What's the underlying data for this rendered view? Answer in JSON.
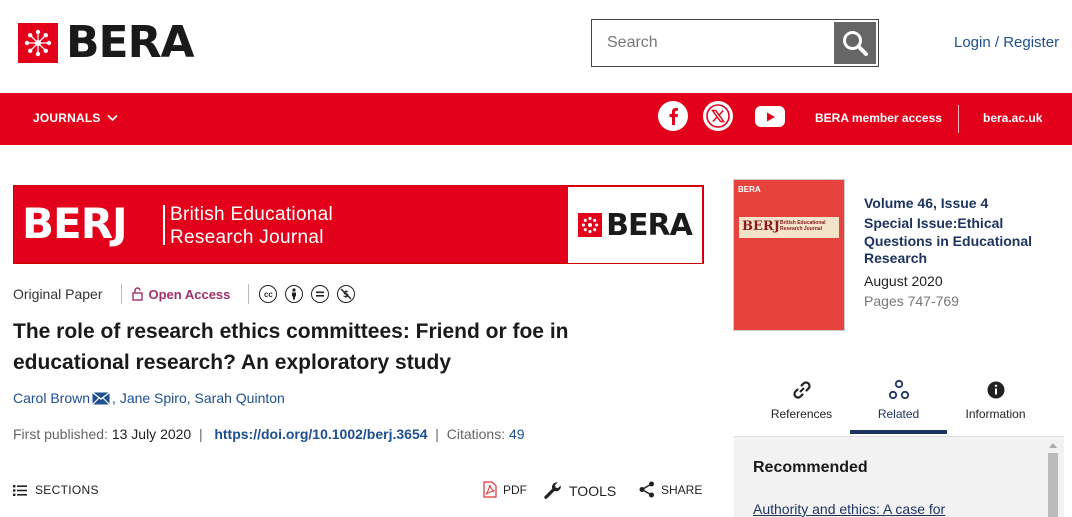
{
  "header": {
    "brand": "BERA",
    "search_placeholder": "Search",
    "login_label": "Login / Register"
  },
  "nav": {
    "journals_label": "JOURNALS",
    "member_access": "BERA member access",
    "site_link": "bera.ac.uk",
    "socials": [
      "facebook-icon",
      "x-icon",
      "youtube-icon"
    ]
  },
  "banner": {
    "abbr": "BERJ",
    "line1": "British Educational",
    "line2": "Research Journal",
    "brand": "BERA"
  },
  "article": {
    "type": "Original Paper",
    "access": "Open Access",
    "title": "The role of research ethics committees: Friend or foe in educational research? An exploratory study",
    "authors": [
      "Carol Brown",
      "Jane Spiro",
      "Sarah Quinton"
    ],
    "first_published_label": "First published:",
    "first_published_date": "13 July 2020",
    "doi": "https://doi.org/10.1002/berj.3654",
    "citations_label": "Citations:",
    "citations": "49"
  },
  "toolbar": {
    "sections": "SECTIONS",
    "pdf": "PDF",
    "tools": "TOOLS",
    "share": "SHARE"
  },
  "issue": {
    "cover_logo": "BERA",
    "cover_title": "BERJ",
    "cover_sub": "British Educational Research Journal",
    "volume": "Volume 46, Issue 4",
    "special": "Special Issue:Ethical Questions in Educational Research",
    "date": "August 2020",
    "pages": "Pages 747-769"
  },
  "tabs": [
    {
      "label": "References"
    },
    {
      "label": "Related"
    },
    {
      "label": "Information"
    }
  ],
  "recommended": {
    "heading": "Recommended",
    "first_link": "Authority and ethics: A case for"
  },
  "colors": {
    "brand_red": "#e2001a",
    "link_blue": "#1d4f91",
    "navy": "#1d3461",
    "open_access": "#a0306b"
  }
}
